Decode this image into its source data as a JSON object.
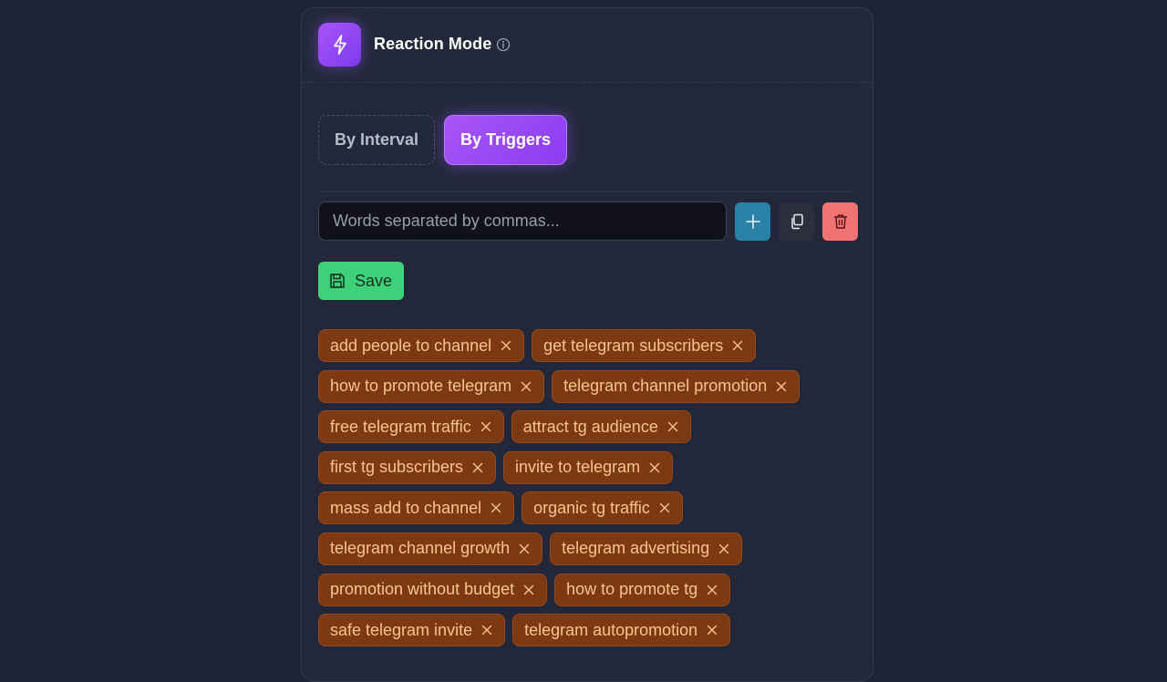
{
  "header": {
    "title": "Reaction Mode",
    "mode_icon": "lightning-icon",
    "info_icon": "info-icon"
  },
  "modes": {
    "interval_label": "By Interval",
    "triggers_label": "By Triggers",
    "active": "triggers"
  },
  "input": {
    "placeholder": "Words separated by commas...",
    "value": ""
  },
  "actions": {
    "add_icon": "plus-icon",
    "copy_icon": "copy-icon",
    "delete_icon": "trash-icon"
  },
  "save": {
    "label": "Save",
    "icon": "floppy-disk-icon"
  },
  "tags": [
    [
      "add people to channel",
      "get telegram subscribers"
    ],
    [
      "how to promote telegram",
      "telegram channel promotion"
    ],
    [
      "free telegram traffic",
      "attract tg audience"
    ],
    [
      "first tg subscribers",
      "invite to telegram"
    ],
    [
      "mass add to channel",
      "organic tg traffic"
    ],
    [
      "telegram channel growth",
      "telegram advertising"
    ],
    [
      "promotion without budget",
      "how to promote tg"
    ],
    [
      "safe telegram invite",
      "telegram autopromotion"
    ]
  ],
  "colors": {
    "background": "#1e2436",
    "panel": "#222839",
    "accent_purple": "#a855f7",
    "add_blue": "#2b80a8",
    "delete_red": "#f07373",
    "save_green": "#3fd07a",
    "tag_bg": "#7d3a12",
    "tag_text": "#f7c58c"
  }
}
